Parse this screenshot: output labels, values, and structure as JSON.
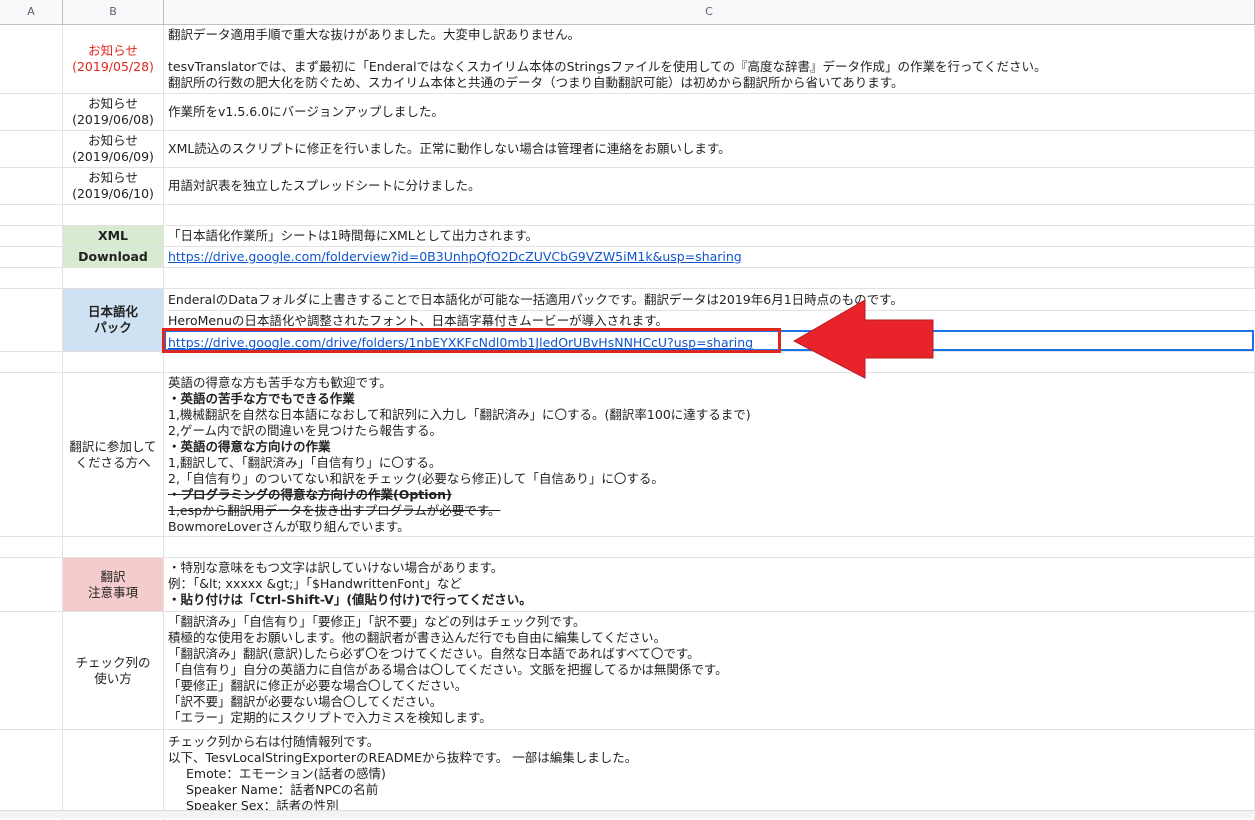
{
  "columns": [
    "A",
    "B",
    "C"
  ],
  "notices": [
    {
      "label": "お知らせ",
      "date": "(2019/05/28)",
      "lines": [
        "翻訳データ適用手順で重大な抜けがありました。大変申し訳ありません。",
        "",
        "tesvTranslatorでは、まず最初に「Enderalではなくスカイリム本体のStringsファイルを使用しての『高度な辞書』データ作成」の作業を行ってください。",
        "翻訳所の行数の肥大化を防ぐため、スカイリム本体と共通のデータ（つまり自動翻訳可能）は初めから翻訳所から省いてあります。"
      ]
    },
    {
      "label": "お知らせ",
      "date": "(2019/06/08)",
      "text": "作業所をv1.5.6.0にバージョンアップしました。"
    },
    {
      "label": "お知らせ",
      "date": "(2019/06/09)",
      "text": "XML読込のスクリプトに修正を行いました。正常に動作しない場合は管理者に連絡をお願いします。"
    },
    {
      "label": "お知らせ",
      "date": "(2019/06/10)",
      "text": "用語対訳表を独立したスプレッドシートに分けました。"
    }
  ],
  "xml": {
    "label_top": "XML",
    "label_bottom": "Download",
    "text": "「日本語化作業所」シートは1時間毎にXMLとして出力されます。",
    "link": "https://drive.google.com/folderview?id=0B3UnhpQfO2DcZUVCbG9VZW5iM1k&usp=sharing"
  },
  "pack": {
    "label_line1": "日本語化",
    "label_line2": "パック",
    "line1": "EnderalのDataフォルダに上書きすることで日本語化が可能な一括適用パックです。翻訳データは2019年6月1日時点のものです。",
    "line2": "HeroMenuの日本語化や調整されたフォント、日本語字幕付きムービーが導入されます。",
    "link": "https://drive.google.com/drive/folders/1nbEYXKFcNdl0mb1JledOrUBvHsNNHCcU?usp=sharing"
  },
  "participate": {
    "label_line1": "翻訳に参加して",
    "label_line2": "くださる方へ",
    "lines": [
      "英語の得意な方も苦手な方も歓迎です。",
      "・英語の苦手な方でもできる作業",
      "1,機械翻訳を自然な日本語になおして和訳列に入力し「翻訳済み」に〇する。(翻訳率100に達するまで)",
      "2,ゲーム内で訳の間違いを見つけたら報告する。",
      "・英語の得意な方向けの作業",
      "1,翻訳して、「翻訳済み」「自信有り」に〇する。",
      "2,「自信有り」のついてない和訳をチェック(必要なら修正)して「自信あり」に〇する。",
      "・プログラミングの得意な方向けの作業(Option)",
      "1,espから翻訳用データを抜き出すプログラムが必要です。",
      "BowmoreLoverさんが取り組んでいます。"
    ]
  },
  "notes": {
    "label_line1": "翻訳",
    "label_line2": "注意事項",
    "lines": [
      "・特別な意味をもつ文字は訳していけない場合があります。",
      "例：「&lt; xxxxx &gt;」「$HandwrittenFont」など",
      "・貼り付けは「Ctrl-Shift-V」(値貼り付け)で行ってください。"
    ]
  },
  "check": {
    "label_line1": "チェック列の",
    "label_line2": "使い方",
    "lines": [
      "「翻訳済み」「自信有り」「要修正」「訳不要」などの列はチェック列です。",
      "積極的な使用をお願いします。他の翻訳者が書き込んだ行でも自由に編集してください。",
      "「翻訳済み」翻訳(意訳)したら必ず〇をつけてください。自然な日本語であればすべて〇です。",
      "「自信有り」自分の英語力に自信がある場合は〇してください。文脈を把握してるかは無関係です。",
      "「要修正」翻訳に修正が必要な場合〇してください。",
      "「訳不要」翻訳が必要ない場合〇してください。",
      "「エラー」定期的にスクリプトで入力ミスを検知します。"
    ]
  },
  "info": {
    "lines": [
      "チェック列から右は付随情報列です。",
      "以下、TesvLocalStringExporterのREADMEから抜粋です。 一部は編集しました。",
      "Emote：エモーション(話者の感情)",
      "Speaker Name：話者NPCの名前",
      "Speaker Sex：話者の性別"
    ]
  },
  "colors": {
    "highlight": "#e0261d",
    "selection": "#1a73e8",
    "link": "#1155cc"
  }
}
